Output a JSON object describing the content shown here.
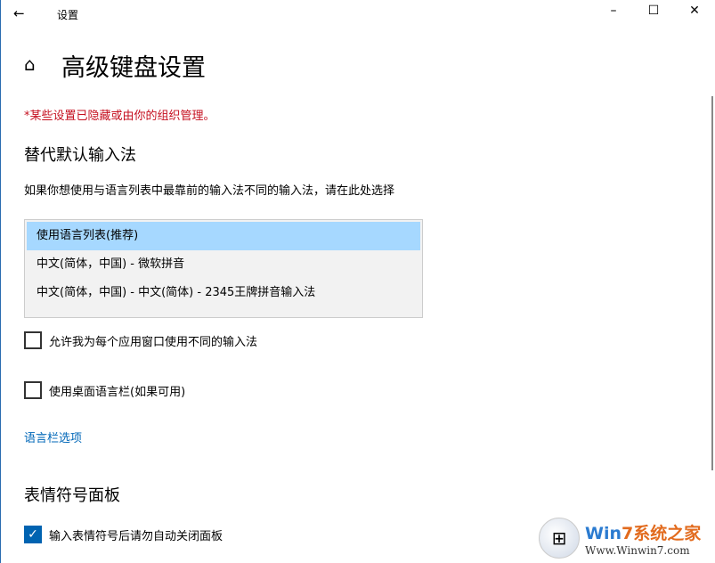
{
  "window": {
    "title": "设置",
    "minimize": "–",
    "maximize": "☐",
    "close": "✕",
    "back": "←"
  },
  "page": {
    "title": "高级键盘设置",
    "managed_notice": "*某些设置已隐藏或由你的组织管理。"
  },
  "override": {
    "heading": "替代默认输入法",
    "description": "如果你想使用与语言列表中最靠前的输入法不同的输入法，请在此处选择",
    "options": [
      "使用语言列表(推荐)",
      "中文(简体，中国) - 微软拼音",
      "中文(简体，中国) - 中文(简体) - 2345王牌拼音输入法"
    ],
    "selected": 0
  },
  "checkboxes": [
    {
      "label": "允许我为每个应用窗口使用不同的输入法",
      "checked": false
    },
    {
      "label": "使用桌面语言栏(如果可用)",
      "checked": false
    }
  ],
  "language_bar_link": "语言栏选项",
  "emoji": {
    "heading": "表情符号面板",
    "checkbox": {
      "label": "输入表情符号后请勿自动关闭面板",
      "checked": true
    }
  },
  "watermark": {
    "brand_a": "Win",
    "brand_b": "7系统之家",
    "url": "Www.Winwin7.com"
  }
}
